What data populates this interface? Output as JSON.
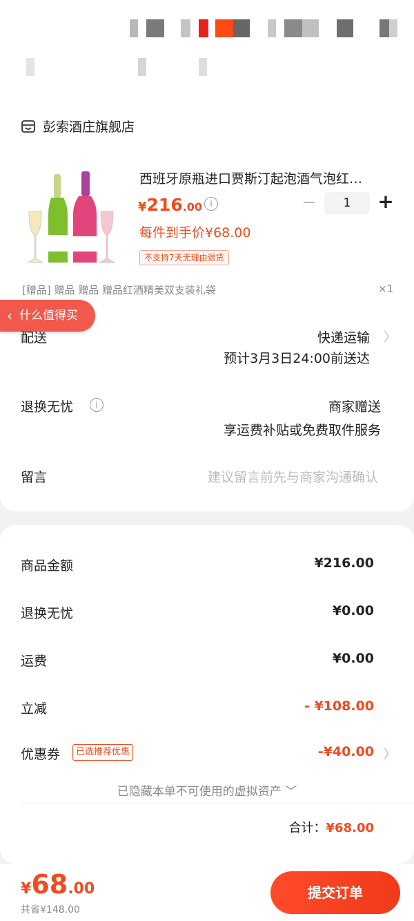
{
  "shop": {
    "name": "彭索酒庄旗舰店"
  },
  "product": {
    "title": "西班牙原瓶进口贾斯汀起泡酒气泡红…",
    "price_symbol": "¥",
    "price_int": "216",
    "price_dec": ".00",
    "unit_price": "每件到手价¥68.00",
    "return_tag": "不支持7天无理由退货",
    "quantity": "1",
    "gift_text": "[赠品]  赠品 赠品 赠品红酒精美双支装礼袋",
    "gift_qty": "×1"
  },
  "floating_tag": {
    "label": "什么值得买"
  },
  "delivery": {
    "label": "配送",
    "method": "快递运输",
    "estimate": "预计3月3日24:00前送达"
  },
  "return_service": {
    "label": "退换无忧",
    "value": "商家赠送",
    "desc": "享运费补贴或免费取件服务"
  },
  "message": {
    "label": "留言",
    "placeholder": "建议留言前先与商家沟通确认"
  },
  "summary": {
    "goods_label": "商品金额",
    "goods_value": "¥216.00",
    "return_label": "退换无忧",
    "return_value": "¥0.00",
    "shipping_label": "运费",
    "shipping_value": "¥0.00",
    "discount_label": "立减",
    "discount_value": "- ¥108.00",
    "coupon_label": "优惠券",
    "coupon_tag": "已选推荐优惠",
    "coupon_value": "-¥40.00",
    "hidden_note": "已隐藏本单不可使用的虚拟资产 ﹀",
    "total_label": "合计：",
    "total_value": "¥68.00"
  },
  "footer": {
    "symbol": "¥",
    "int": "68",
    "dec": ".00",
    "saved": "共省¥148.00",
    "submit_label": "提交订单"
  },
  "colors": {
    "accent": "#f04b1e",
    "float_tag": "#f0594b"
  }
}
